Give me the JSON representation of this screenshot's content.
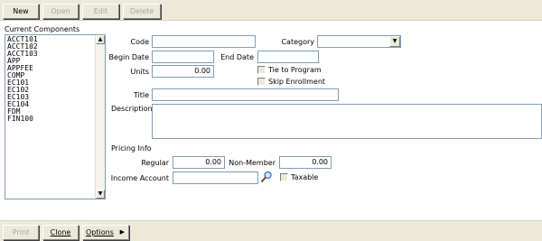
{
  "toolbar_top": {
    "new": "New",
    "open": "Open",
    "edit": "Edit",
    "delete": "Delete"
  },
  "components": {
    "label": "Current Components",
    "items": [
      "ACCT101",
      "ACCT102",
      "ACCT103",
      "APP",
      "APPFEE",
      "COMP",
      "EC101",
      "EC102",
      "EC103",
      "EC104",
      "FDM",
      "FIN100"
    ]
  },
  "form": {
    "code_label": "Code",
    "code_value": "",
    "category_label": "Category",
    "category_value": "",
    "begin_date_label": "Begin Date",
    "begin_date_value": "",
    "end_date_label": "End Date",
    "end_date_value": "",
    "units_label": "Units",
    "units_value": "0.00",
    "tie_label": "Tie to Program",
    "skip_label": "Skip Enrollment",
    "title_label": "Title",
    "title_value": "",
    "description_label": "Description",
    "description_value": ""
  },
  "pricing": {
    "header": "Pricing Info",
    "regular_label": "Regular",
    "regular_value": "0.00",
    "nonmember_label": "Non-Member",
    "nonmember_value": "0.00",
    "income_label": "Income Account",
    "income_value": "",
    "taxable_label": "Taxable"
  },
  "toolbar_bottom": {
    "print": "Print",
    "clone": "Clone",
    "options": "Options"
  },
  "colors": {
    "toolbar": "#ece9d8",
    "field_border": "#7f9db9",
    "disabled_text": "#a7a6aa"
  }
}
